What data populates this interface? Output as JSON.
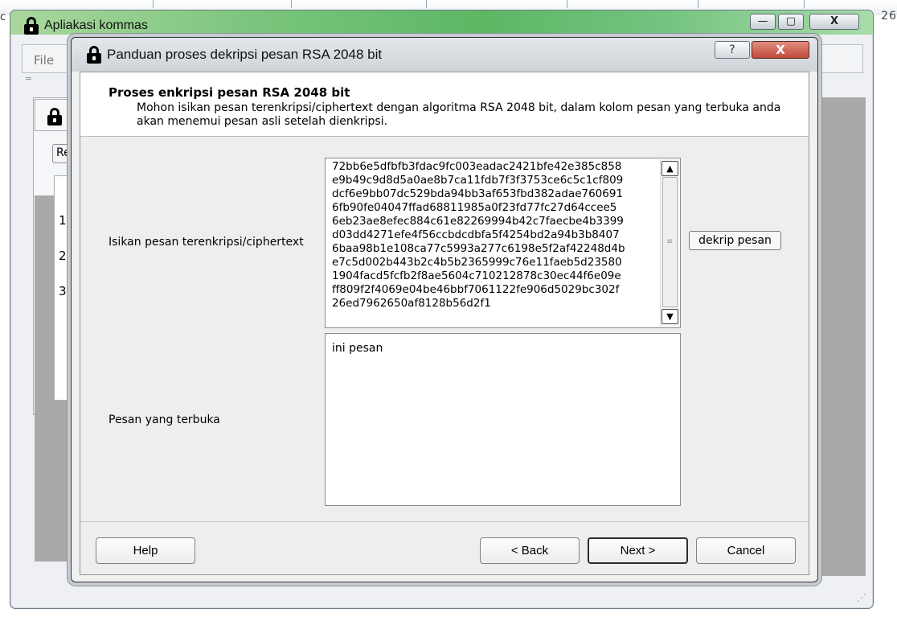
{
  "main_window": {
    "title": "Apliakasi kommas",
    "menu": {
      "file_label": "File"
    },
    "bg_button_label": "Re",
    "bg_row_numbers": [
      "1",
      "2",
      "3"
    ],
    "edge_left_text": "c",
    "edge_right_text": "26"
  },
  "dialog": {
    "title": "Panduan proses dekripsi pesan RSA 2048 bit",
    "help_title_button": "?",
    "close_title_button": "X",
    "header": {
      "title": "Proses enkripsi pesan RSA 2048 bit",
      "subtitle": "Mohon isikan pesan terenkripsi/ciphertext dengan algoritma RSA 2048 bit, dalam kolom pesan yang terbuka anda akan menemui pesan asli setelah dienkripsi."
    },
    "cipher_label": "Isikan pesan terenkripsi/ciphertext",
    "cipher_text": "72bb6e5dfbfb3fdac9fc003eadac2421bfe42e385c858\ne9b49c9d8d5a0ae8b7ca11fdb7f3f3753ce6c5c1cf809\ndcf6e9bb07dc529bda94bb3af653fbd382adae760691\n6fb90fe04047ffad68811985a0f23fd77fc27d64ccee5\n6eb23ae8efec884c61e82269994b42c7faecbe4b3399\nd03dd4271efe4f56ccbdcdbfa5f4254bd2a94b3b8407\n6baa98b1e108ca77c5993a277c6198e5f2af42248d4b\ne7c5d002b443b2c4b5b2365999c76e11faeb5d23580\n1904facd5fcfb2f8ae5604c710212878c30ec44f6e09e\nff809f2f4069e04be46bbf7061122fe906d5029bc302f\n26ed7962650af8128b56d2f1",
    "decrypt_button": "dekrip pesan",
    "plain_label": "Pesan yang terbuka",
    "plain_text": "ini pesan",
    "buttons": {
      "help": "Help",
      "back": "< Back",
      "next": "Next >",
      "cancel": "Cancel"
    }
  },
  "icons": [
    "lock-icon",
    "scroll-up-icon",
    "scroll-down-icon",
    "minimize-icon",
    "maximize-icon",
    "close-icon"
  ],
  "colors": {
    "titlebar_green": "#5cb764",
    "close_red": "#c14b3a",
    "backdrop_gray": "#a9a9a9"
  }
}
